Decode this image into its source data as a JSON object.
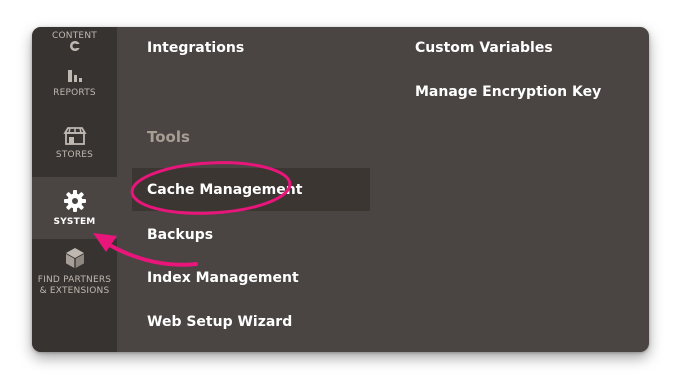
{
  "colors": {
    "sidebar_bg": "#373330",
    "panel_bg": "#4a4542",
    "active_item_bg": "#4a4542",
    "section_title": "#a79d95",
    "annotation": "#e8157a"
  },
  "sidebar": {
    "items": [
      {
        "label": "CONTENT",
        "icon": "content-icon",
        "active": false
      },
      {
        "label": "REPORTS",
        "icon": "bar-chart-icon",
        "active": false
      },
      {
        "label": "STORES",
        "icon": "storefront-icon",
        "active": false
      },
      {
        "label": "SYSTEM",
        "icon": "gear-icon",
        "active": true
      },
      {
        "label": "FIND PARTNERS & EXTENSIONS",
        "label_line1": "FIND PARTNERS",
        "label_line2": "& EXTENSIONS",
        "icon": "cube-icon",
        "active": false
      }
    ]
  },
  "menu": {
    "col1": {
      "links_top": [
        "Integrations"
      ],
      "section_title": "Tools",
      "tools": [
        "Cache Management",
        "Backups",
        "Index Management",
        "Web Setup Wizard"
      ]
    },
    "col2": {
      "links": [
        "Custom Variables",
        "Manage Encryption Key"
      ]
    }
  },
  "annotation": {
    "highlight_target": "Cache Management",
    "arrow_points_to": "SYSTEM"
  }
}
